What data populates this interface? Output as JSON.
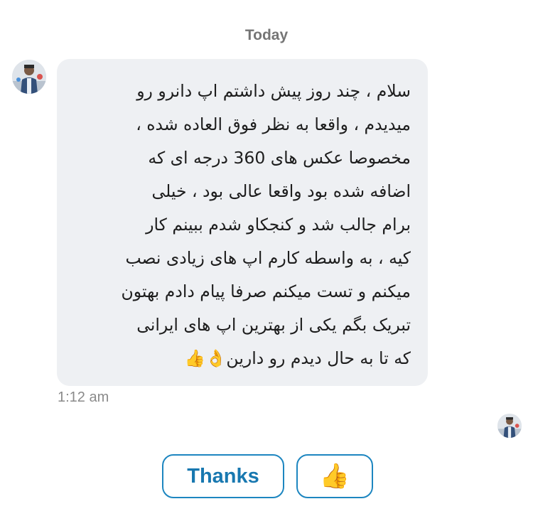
{
  "conversation": {
    "day_label": "Today"
  },
  "message": {
    "text": "سلام ، چند روز پیش داشتم اپ دانرو رو\nمیدیدم ، واقعا به نظر فوق العاده شده ،\nمخصوصا عکس های 360 درجه ای که\nاضافه شده بود واقعا عالی بود ، خیلی\nبرام جالب شد و کنجکاو شدم ببینم کار\nکیه ، به واسطه کارم اپ های زیادی نصب\nمیکنم و تست میکنم صرفا پیام دادم بهتون\nتبریک بگم یکی از بهترین اپ های ایرانی\nکه تا به حال دیدم رو دارین👌👍",
    "time": "1:12 am"
  },
  "quick_replies": {
    "thanks_label": "Thanks",
    "thumb_label": "👍"
  },
  "colors": {
    "bubble_bg": "#eef0f3",
    "accent": "#1d86c0",
    "meta_text": "#8a8a8a"
  }
}
